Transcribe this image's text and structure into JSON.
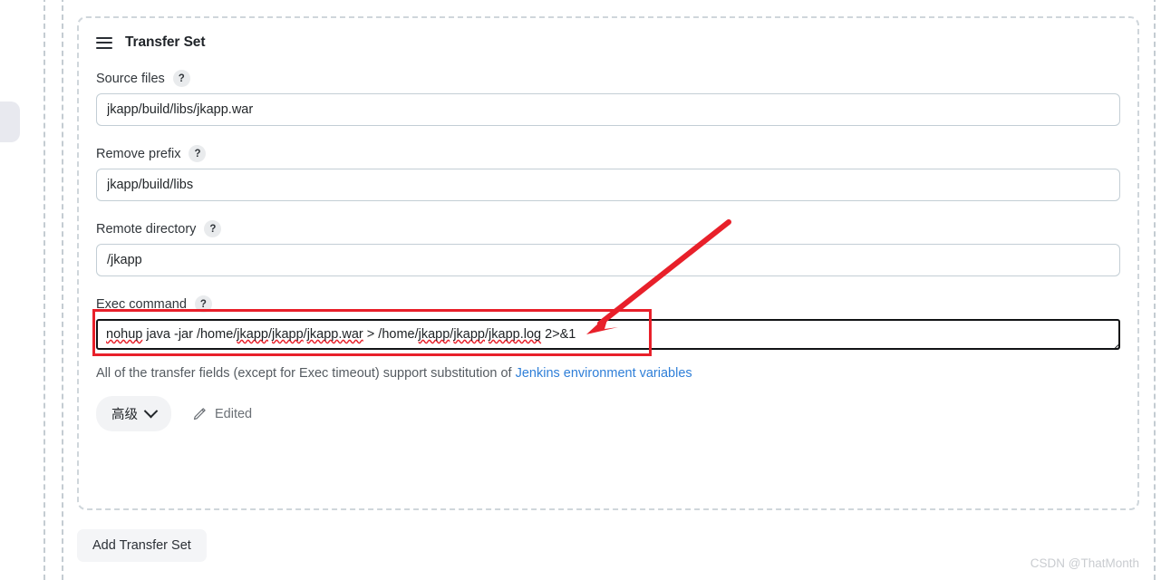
{
  "card": {
    "title": "Transfer Set",
    "drag_handle_icon": "hamburger-icon"
  },
  "fields": [
    {
      "label": "Source files",
      "help": "?",
      "value": "jkapp/build/libs/jkapp.war"
    },
    {
      "label": "Remove prefix",
      "help": "?",
      "value": "jkapp/build/libs"
    },
    {
      "label": "Remote directory",
      "help": "?",
      "value": "/jkapp"
    }
  ],
  "exec": {
    "label": "Exec command",
    "help": "?",
    "value_parts": [
      {
        "text": "nohup",
        "misspelled": true
      },
      {
        "text": " java -jar /home/",
        "misspelled": false
      },
      {
        "text": "jkapp",
        "misspelled": true
      },
      {
        "text": "/",
        "misspelled": false
      },
      {
        "text": "jkapp",
        "misspelled": true
      },
      {
        "text": "/",
        "misspelled": false
      },
      {
        "text": "jkapp.war",
        "misspelled": true
      },
      {
        "text": " > /home/",
        "misspelled": false
      },
      {
        "text": "jkapp",
        "misspelled": true
      },
      {
        "text": "/",
        "misspelled": false
      },
      {
        "text": "jkapp",
        "misspelled": true
      },
      {
        "text": "/",
        "misspelled": false
      },
      {
        "text": "jkapp.log",
        "misspelled": true
      },
      {
        "text": " 2>&1",
        "misspelled": false
      }
    ]
  },
  "hint": {
    "prefix": "All of the transfer fields (except for Exec timeout) support substitution of ",
    "link_text": "Jenkins environment variables"
  },
  "actions": {
    "advanced_label": "高级",
    "advanced_chevron_icon": "chevron-down-icon",
    "edited_label": "Edited",
    "edited_icon": "pencil-icon"
  },
  "add_transfer_set_label": "Add Transfer Set",
  "watermark": "CSDN @ThatMonth",
  "colors": {
    "annotation_red": "#e8202a",
    "link_blue": "#2f7fd8",
    "input_border": "#c3ced5"
  }
}
